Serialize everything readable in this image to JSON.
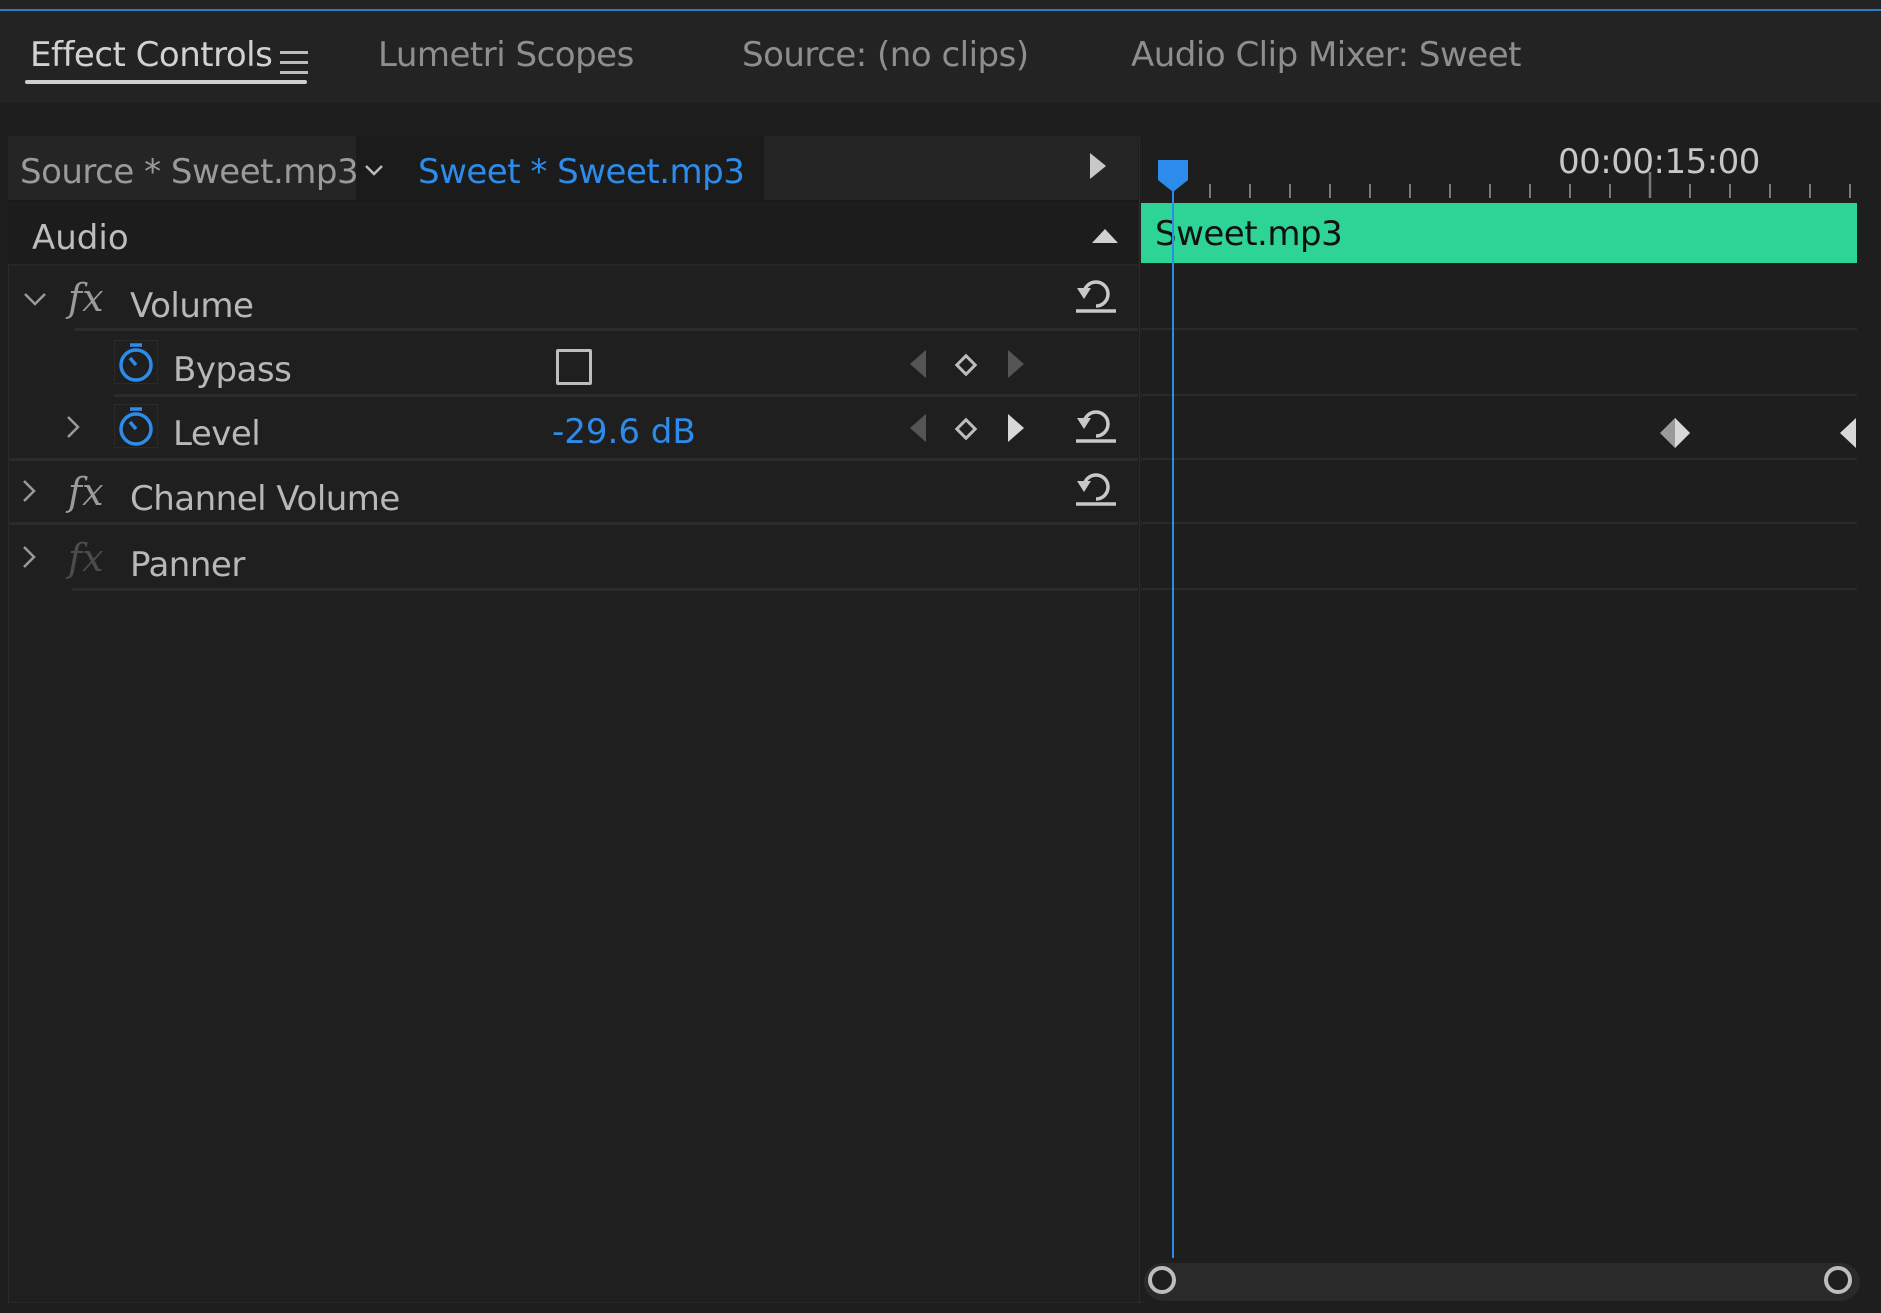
{
  "tabs": [
    {
      "label": "Effect Controls",
      "active": true
    },
    {
      "label": "Lumetri Scopes"
    },
    {
      "label": "Source: (no clips)"
    },
    {
      "label": "Audio Clip Mixer: Sweet"
    }
  ],
  "source": {
    "master_label": "Source * Sweet.mp3",
    "clip_label": "Sweet * Sweet.mp3"
  },
  "section": {
    "label": "Audio"
  },
  "effects": {
    "volume": {
      "label": "Volume",
      "bypass": {
        "label": "Bypass",
        "checked": false
      },
      "level": {
        "label": "Level",
        "value": "-29.6 dB"
      }
    },
    "channel_volume": {
      "label": "Channel Volume"
    },
    "panner": {
      "label": "Panner"
    }
  },
  "timeline": {
    "time_label": "00:00:15:00",
    "clip_name": "Sweet.mp3"
  },
  "colors": {
    "accent": "#2d8ceb",
    "clip": "#2ed495",
    "background": "#1e1e1e"
  },
  "icons": [
    "menu-icon",
    "chevron-down-icon",
    "play-icon",
    "collapse-up-icon",
    "fx-icon",
    "stopwatch-icon",
    "reset-icon",
    "keyframe-icon"
  ]
}
